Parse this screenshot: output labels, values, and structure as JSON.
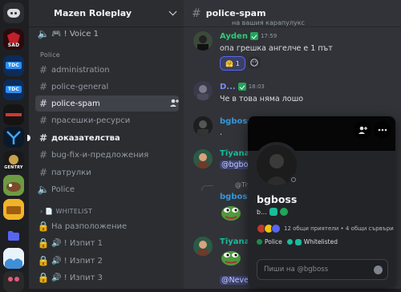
{
  "servers": [
    {
      "name": "home",
      "label": ""
    },
    {
      "name": "server-sad",
      "label": "SAD"
    },
    {
      "name": "server-tdc-1",
      "label": "TDC"
    },
    {
      "name": "server-tdc-2",
      "label": "TDC"
    },
    {
      "name": "server-racing",
      "label": ""
    },
    {
      "name": "server-blue-emblem",
      "label": ""
    },
    {
      "name": "server-gentry",
      "label": "GENTRY"
    },
    {
      "name": "server-cow",
      "label": ""
    },
    {
      "name": "server-bus",
      "label": ""
    },
    {
      "name": "server-folder",
      "label": ""
    },
    {
      "name": "server-landscape",
      "label": ""
    },
    {
      "name": "server-hearts",
      "label": ""
    }
  ],
  "guild": {
    "name": "Mazen Roleplay"
  },
  "sidebar": {
    "top_voice": "🎮 ! Voice 1",
    "category_police": "Police",
    "channels": [
      {
        "label": "administration",
        "state": "normal"
      },
      {
        "label": "police-general",
        "state": "normal"
      },
      {
        "label": "police-spam",
        "state": "active"
      },
      {
        "label": "прасешки-ресурси",
        "state": "normal"
      },
      {
        "label": "доказателства",
        "state": "unread"
      },
      {
        "label": "bug-fix-и-предложения",
        "state": "normal"
      },
      {
        "label": "патрулки",
        "state": "normal"
      },
      {
        "label": "Police",
        "state": "voice"
      }
    ],
    "category_whitelist": "📄 WHITELIST",
    "locked": [
      {
        "label": "На разположение"
      },
      {
        "label": "🔊 ! Изпит 1"
      },
      {
        "label": "🔊 ! Изпит 2"
      },
      {
        "label": "🔊 ! Изпит 3"
      }
    ]
  },
  "channel": {
    "name": "police-spam"
  },
  "messages": {
    "top_cut": "на вашия карапулукс",
    "m1": {
      "author": "Ayden",
      "time": "17:59",
      "text": "опа грешка ангелче е 1 път",
      "reaction": "🤗 1"
    },
    "m2": {
      "author": "D...",
      "time": "18:03",
      "text": "Че в това няма лошо"
    },
    "m3": {
      "author": "bgboss",
      "text": "."
    },
    "m4": {
      "author": "Tiyana.",
      "mention": "@bgboss"
    },
    "m5": {
      "reply": "@Tiya",
      "author": "bgboss"
    },
    "m6": {
      "author": "Tiyana.",
      "mention": "@Never"
    }
  },
  "popout": {
    "username": "bgboss",
    "tag": "b...",
    "mutual": "12 общи приятели • 4 общи сървъри",
    "roles": [
      {
        "name": "Police",
        "color": "#1f8b4c"
      },
      {
        "name": "Whitelisted",
        "color": "#1abc9c"
      }
    ],
    "input_placeholder": "Пиши на @bgboss"
  },
  "colors": {
    "ayden": "#2ecc71",
    "tiyana": "#1abc9c",
    "bgboss": "#3498db",
    "d_user": "#5865f2",
    "active_bg": "#404249"
  }
}
